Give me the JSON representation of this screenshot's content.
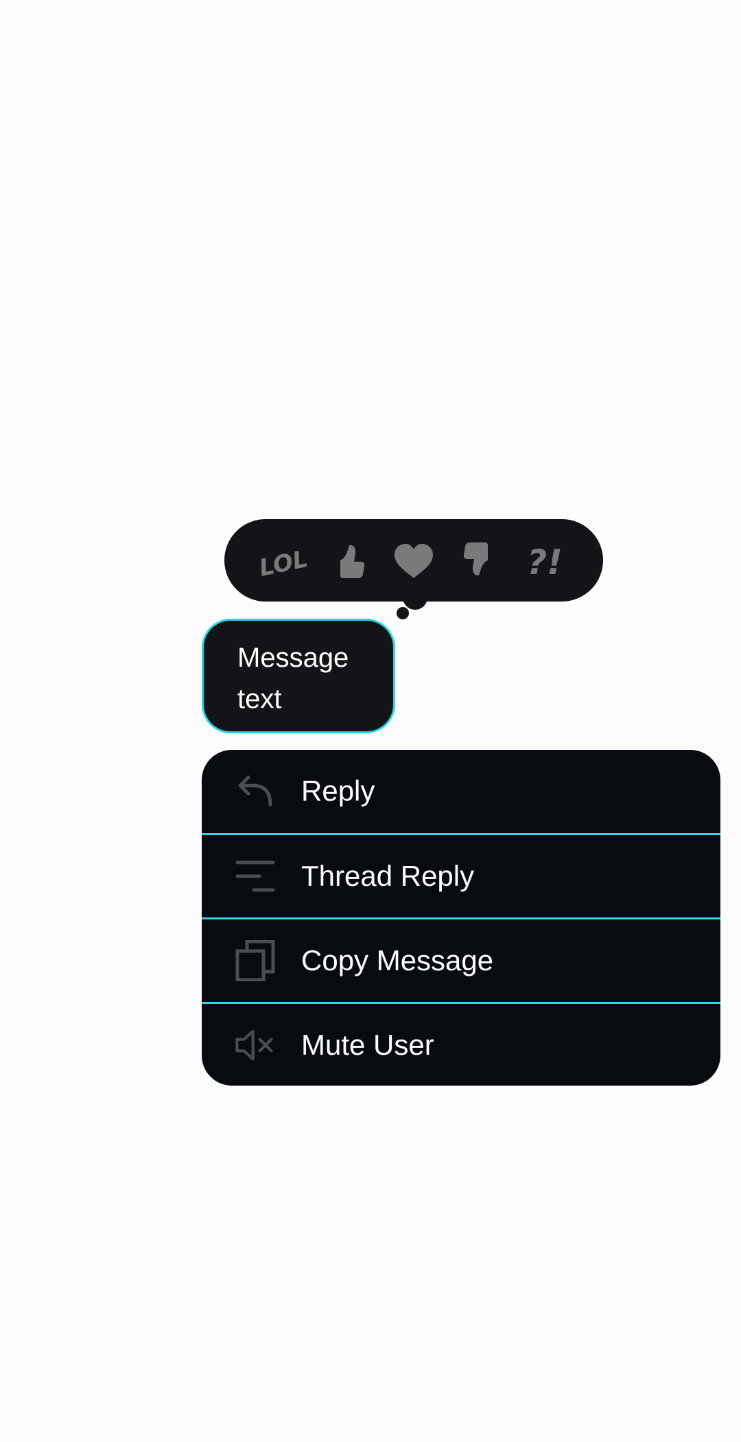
{
  "reactions": [
    {
      "icon": "lol-icon",
      "label": "LOL"
    },
    {
      "icon": "thumbs-up-icon"
    },
    {
      "icon": "heart-icon"
    },
    {
      "icon": "thumbs-down-icon"
    },
    {
      "icon": "surprise-icon",
      "label": "?!"
    }
  ],
  "message": {
    "text": "Message text"
  },
  "menu": {
    "items": [
      {
        "label": "Reply",
        "icon": "reply-icon"
      },
      {
        "label": "Thread Reply",
        "icon": "thread-reply-icon"
      },
      {
        "label": "Copy Message",
        "icon": "copy-icon"
      },
      {
        "label": "Mute User",
        "icon": "mute-icon"
      }
    ]
  },
  "colors": {
    "accent": "#2ad4e0",
    "surface": "#121418",
    "menu_background": "#080c10",
    "icon_gray": "#7a7a7a",
    "text": "#ffffff",
    "page_background": "#fcfcfc"
  }
}
